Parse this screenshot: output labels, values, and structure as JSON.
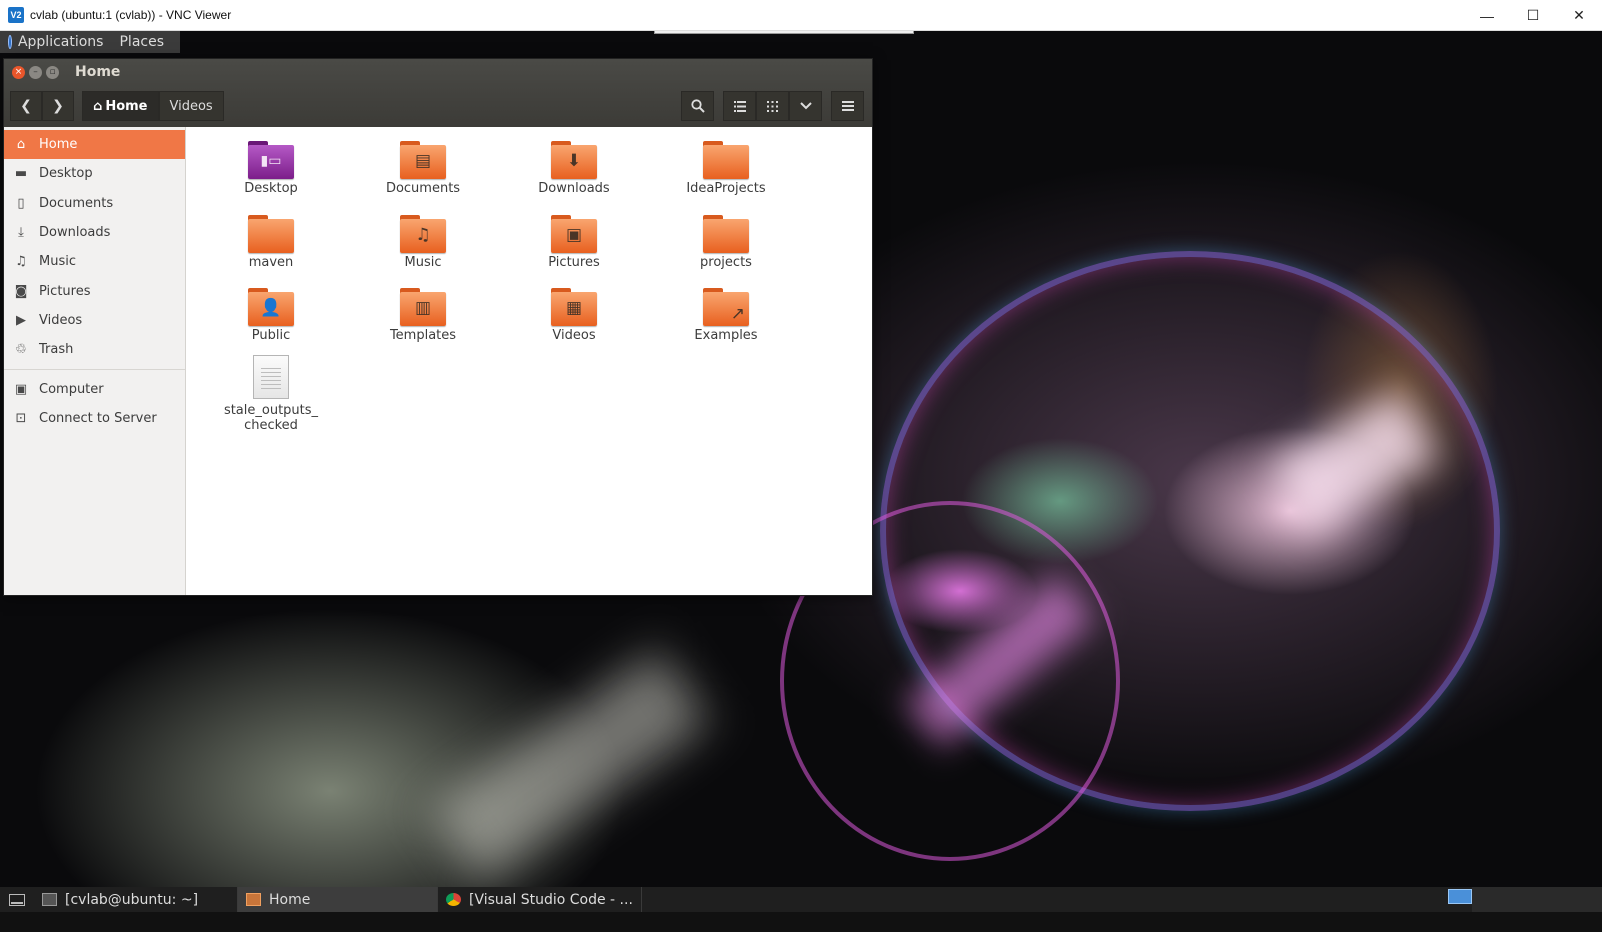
{
  "vnc": {
    "title": "cvlab (ubuntu:1 (cvlab)) - VNC Viewer",
    "logo": "V2",
    "controls": [
      "—",
      "☐",
      "✕"
    ]
  },
  "panel": {
    "menus": [
      "Applications",
      "Places"
    ]
  },
  "nautilus": {
    "title": "Home",
    "path": [
      "Home",
      "Videos"
    ],
    "sidebar": [
      {
        "label": "Home",
        "icon": "home-icon",
        "selected": true
      },
      {
        "label": "Desktop",
        "icon": "desktop-icon"
      },
      {
        "label": "Documents",
        "icon": "document-icon"
      },
      {
        "label": "Downloads",
        "icon": "download-icon"
      },
      {
        "label": "Music",
        "icon": "music-icon"
      },
      {
        "label": "Pictures",
        "icon": "camera-icon"
      },
      {
        "label": "Videos",
        "icon": "video-icon"
      },
      {
        "label": "Trash",
        "icon": "trash-icon"
      },
      {
        "label": "Computer",
        "icon": "computer-icon"
      },
      {
        "label": "Connect to Server",
        "icon": "server-icon"
      }
    ],
    "items": [
      {
        "label": "Desktop",
        "type": "desktop-folder"
      },
      {
        "label": "Documents",
        "type": "folder",
        "emblem": "document"
      },
      {
        "label": "Downloads",
        "type": "folder",
        "emblem": "download"
      },
      {
        "label": "IdeaProjects",
        "type": "folder"
      },
      {
        "label": "maven",
        "type": "folder"
      },
      {
        "label": "Music",
        "type": "folder",
        "emblem": "music"
      },
      {
        "label": "Pictures",
        "type": "folder",
        "emblem": "picture"
      },
      {
        "label": "projects",
        "type": "folder"
      },
      {
        "label": "Public",
        "type": "folder",
        "emblem": "person"
      },
      {
        "label": "Templates",
        "type": "folder",
        "emblem": "template"
      },
      {
        "label": "Videos",
        "type": "folder",
        "emblem": "film"
      },
      {
        "label": "Examples",
        "type": "folder",
        "emblem": "link"
      },
      {
        "label": "stale_outputs_\nchecked",
        "type": "file"
      }
    ]
  },
  "taskbar": {
    "tasks": [
      {
        "label": "[cvlab@ubuntu: ~]",
        "icon": "terminal-icon"
      },
      {
        "label": "Home",
        "icon": "file-manager-icon",
        "active": true
      },
      {
        "label": "[Visual Studio Code - ...",
        "icon": "chrome-icon"
      }
    ]
  },
  "colors": {
    "accent": "#f07746",
    "header": "#3c3b37",
    "folder": "#e8601f"
  }
}
